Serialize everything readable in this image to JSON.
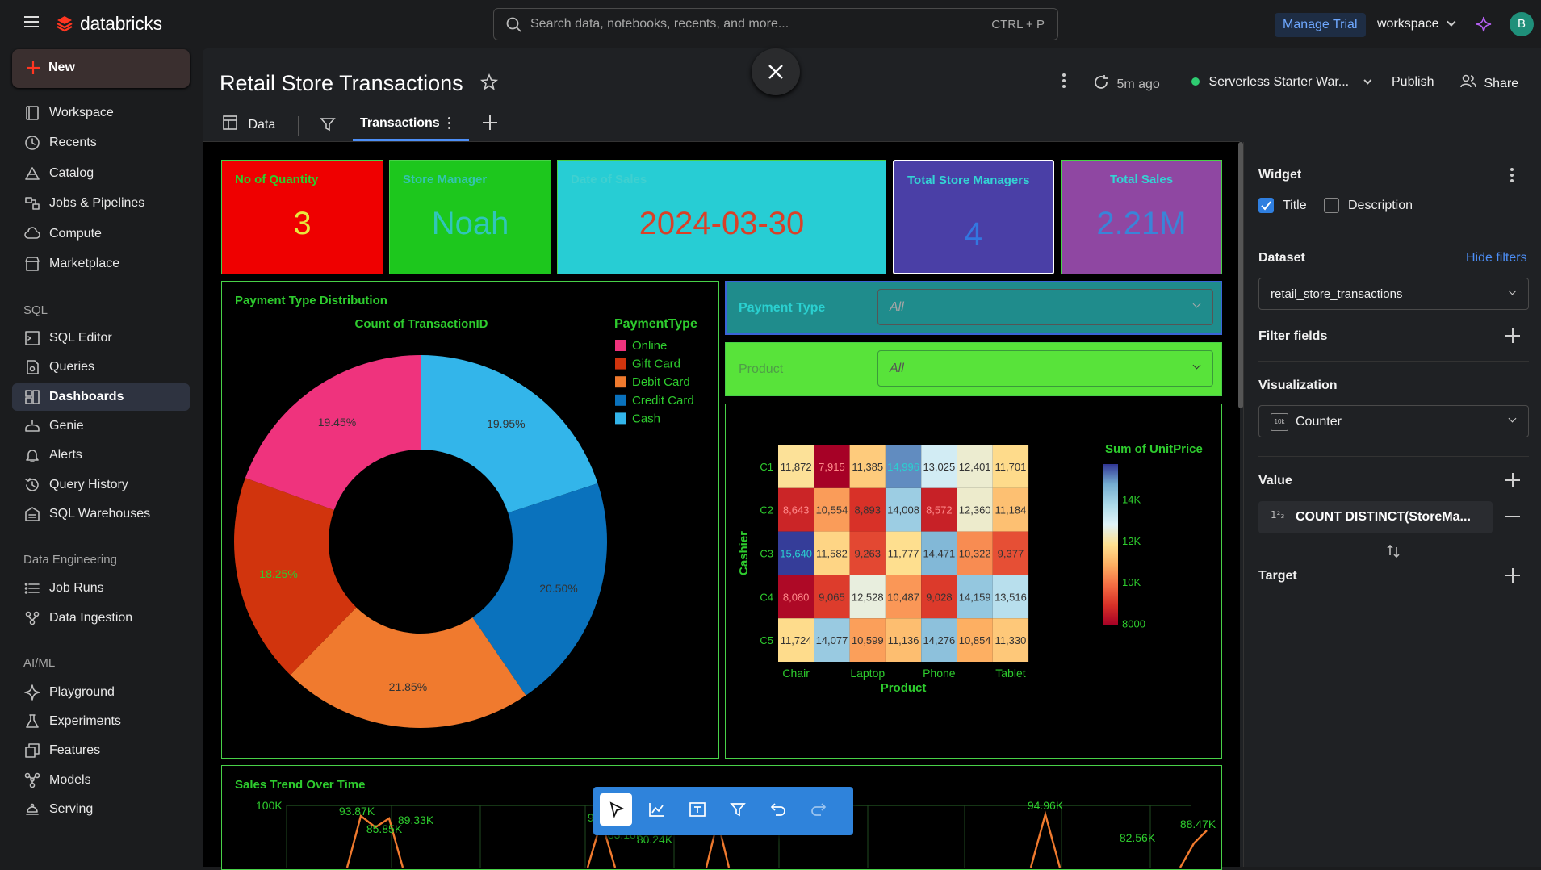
{
  "app": {
    "name": "databricks"
  },
  "search": {
    "placeholder": "Search data, notebooks, recents, and more...",
    "shortcut": "CTRL + P"
  },
  "topbar": {
    "trial": "Manage Trial",
    "workspace": "workspace",
    "avatar": "B"
  },
  "sidebar": {
    "new_label": "New",
    "items": [
      {
        "label": "Workspace",
        "icon": "workspace-icon"
      },
      {
        "label": "Recents",
        "icon": "clock-icon"
      },
      {
        "label": "Catalog",
        "icon": "catalog-icon"
      },
      {
        "label": "Jobs & Pipelines",
        "icon": "jobs-icon"
      },
      {
        "label": "Compute",
        "icon": "cloud-icon"
      },
      {
        "label": "Marketplace",
        "icon": "store-icon"
      }
    ],
    "sql_section": "SQL",
    "sql_items": [
      {
        "label": "SQL Editor",
        "icon": "sql-editor-icon"
      },
      {
        "label": "Queries",
        "icon": "queries-icon"
      },
      {
        "label": "Dashboards",
        "icon": "dashboard-icon"
      },
      {
        "label": "Genie",
        "icon": "genie-icon"
      },
      {
        "label": "Alerts",
        "icon": "bell-icon"
      },
      {
        "label": "Query History",
        "icon": "history-icon"
      },
      {
        "label": "SQL Warehouses",
        "icon": "warehouse-icon"
      }
    ],
    "de_section": "Data Engineering",
    "de_items": [
      {
        "label": "Job Runs",
        "icon": "job-runs-icon"
      },
      {
        "label": "Data Ingestion",
        "icon": "ingestion-icon"
      }
    ],
    "ai_section": "AI/ML",
    "ai_items": [
      {
        "label": "Playground",
        "icon": "playground-icon"
      },
      {
        "label": "Experiments",
        "icon": "flask-icon"
      },
      {
        "label": "Features",
        "icon": "features-icon"
      },
      {
        "label": "Models",
        "icon": "models-icon"
      },
      {
        "label": "Serving",
        "icon": "serving-icon"
      }
    ]
  },
  "dashboard": {
    "title": "Retail Store Transactions",
    "refresh": "5m ago",
    "warehouse": "Serverless Starter War...",
    "publish": "Publish",
    "share": "Share",
    "tabs": {
      "data": "Data",
      "transactions": "Transactions"
    }
  },
  "counters": [
    {
      "title": "No of Quantity",
      "value": "3"
    },
    {
      "title": "Store Manager",
      "value": "Noah"
    },
    {
      "title": "Date of Sales",
      "value": "2024-03-30"
    },
    {
      "title": "Total Store Managers",
      "value": "4"
    },
    {
      "title": "Total Sales",
      "value": "2.21M"
    }
  ],
  "filters": [
    {
      "label": "Payment Type",
      "value": "All"
    },
    {
      "label": "Product",
      "value": "All"
    }
  ],
  "colors": {
    "green": "#2ecc2e",
    "red": "#ef0000",
    "cyan": "#27cdd4",
    "purple": "#4a3fa6",
    "magenta": "#8f47a2",
    "teal": "#1f8c8c"
  },
  "chart_data": [
    {
      "type": "pie",
      "panel_title": "Payment Type Distribution",
      "title": "Count of TransactionID",
      "legend_title": "PaymentType",
      "legend": "top-right",
      "slices": [
        {
          "label": "Cash",
          "value": 19.95,
          "text": "19.95%",
          "color": "#33b5ea"
        },
        {
          "label": "Credit Card",
          "value": 20.5,
          "text": "20.50%",
          "color": "#0a72bd"
        },
        {
          "label": "Debit Card",
          "value": 21.85,
          "text": "21.85%",
          "color": "#f07a2e"
        },
        {
          "label": "Gift Card",
          "value": 18.25,
          "text": "18.25%",
          "color": "#d1340d"
        },
        {
          "label": "Online",
          "value": 19.45,
          "text": "19.45%",
          "color": "#ef337d"
        }
      ],
      "legend_order": [
        "Online",
        "Gift Card",
        "Debit Card",
        "Credit Card",
        "Cash"
      ]
    },
    {
      "type": "heatmap",
      "xlabel": "Product",
      "ylabel": "Cashier",
      "x_tick_labels": [
        "Chair",
        "Laptop",
        "Phone",
        "Tablet"
      ],
      "rows": [
        "C1",
        "C2",
        "C3",
        "C4",
        "C5"
      ],
      "colorbar_title": "Sum of UnitPrice",
      "colorbar_ticks": [
        "14K",
        "12K",
        "10K",
        "8000"
      ],
      "range": [
        7900,
        15700
      ],
      "values": [
        [
          11872,
          7915,
          11385,
          14996,
          13025,
          12401,
          11701
        ],
        [
          8643,
          10554,
          8893,
          14008,
          8572,
          12360,
          11184
        ],
        [
          15640,
          11582,
          9263,
          11777,
          14471,
          10322,
          9377
        ],
        [
          8080,
          9065,
          12528,
          10487,
          9028,
          14159,
          13516
        ],
        [
          11724,
          14077,
          10599,
          11136,
          14276,
          10854,
          11330
        ]
      ]
    },
    {
      "type": "line",
      "panel_title": "Sales Trend Over Time",
      "y_tick": "100K",
      "labels": [
        "93.87K",
        "85.85K",
        "89.33K",
        "91.53K",
        "83.18K",
        "80.24K",
        "94.96K",
        "82.56K",
        "88.47K"
      ]
    }
  ],
  "right_panel": {
    "widget": "Widget",
    "title_opt": "Title",
    "desc_opt": "Description",
    "dataset": "Dataset",
    "hide_filters": "Hide filters",
    "dataset_value": "retail_store_transactions",
    "filter_fields": "Filter fields",
    "visualization": "Visualization",
    "viz_value": "Counter",
    "viz_badge": "10k",
    "value": "Value",
    "value_field": "COUNT DISTINCT(StoreMa...",
    "target": "Target"
  }
}
